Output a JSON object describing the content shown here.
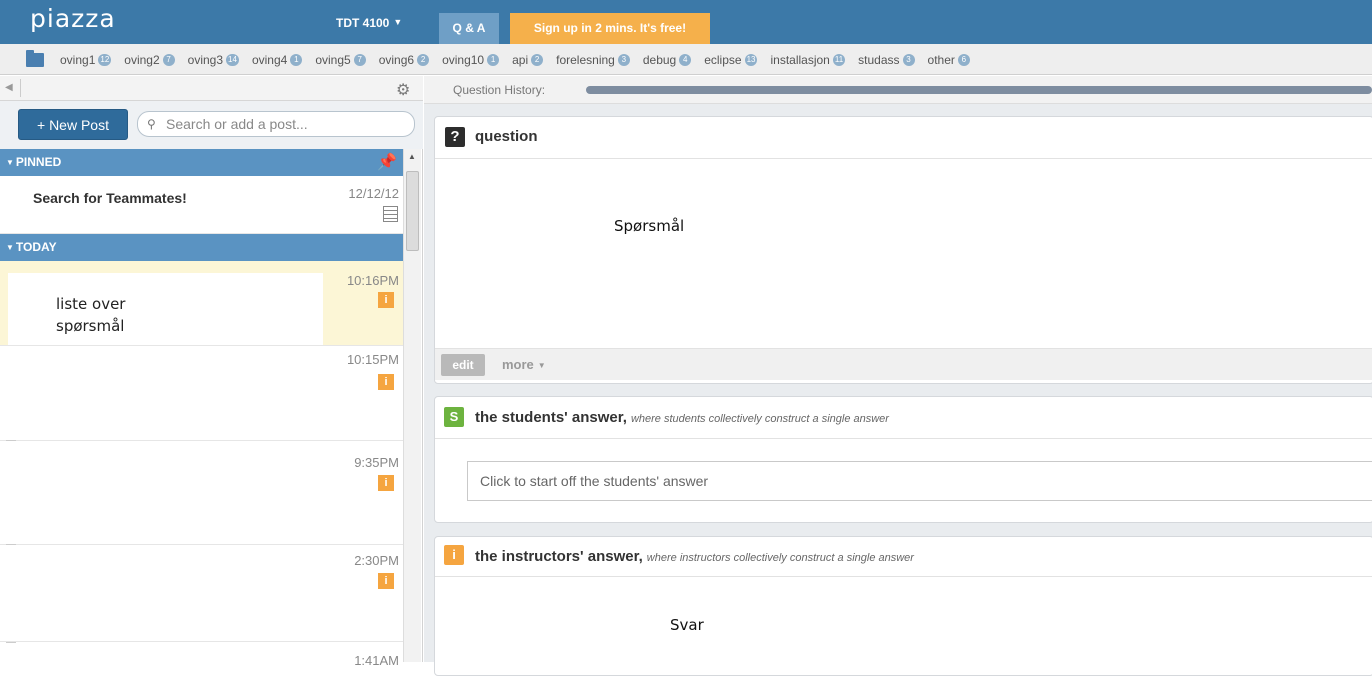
{
  "topbar": {
    "logo": "piazza",
    "course": "TDT 4100",
    "course_caret": "▼",
    "tab_qa": "Q & A",
    "signup": "Sign up in 2 mins. It's free!"
  },
  "folders": [
    {
      "name": "oving1",
      "count": "12"
    },
    {
      "name": "oving2",
      "count": "7"
    },
    {
      "name": "oving3",
      "count": "14"
    },
    {
      "name": "oving4",
      "count": "1"
    },
    {
      "name": "oving5",
      "count": "7"
    },
    {
      "name": "oving6",
      "count": "2"
    },
    {
      "name": "oving10",
      "count": "1"
    },
    {
      "name": "api",
      "count": "2"
    },
    {
      "name": "forelesning",
      "count": "3"
    },
    {
      "name": "debug",
      "count": "4"
    },
    {
      "name": "eclipse",
      "count": "13"
    },
    {
      "name": "installasjon",
      "count": "11"
    },
    {
      "name": "studass",
      "count": "3"
    },
    {
      "name": "other",
      "count": "6"
    }
  ],
  "left": {
    "new_post": "+ New Post",
    "search_placeholder": "Search or add a post...",
    "pinned_label": "PINNED",
    "today_label": "TODAY",
    "pinned_post": {
      "title": "Search for Teammates!",
      "date": "12/12/12"
    },
    "posts": [
      {
        "time": "10:16PM",
        "body_line1": "liste over",
        "body_line2": "spørsmål"
      },
      {
        "time": "10:15PM"
      },
      {
        "time": "9:35PM"
      },
      {
        "time": "2:30PM"
      },
      {
        "time": "1:41AM"
      }
    ],
    "instructor_icon": "i"
  },
  "right": {
    "history_label": "Question History:",
    "question": {
      "icon": "?",
      "title": "question",
      "body": "Spørsmål",
      "edit": "edit",
      "more": "more",
      "more_caret": "▼"
    },
    "students": {
      "icon": "S",
      "title": "the students' answer,",
      "subtitle": "where students collectively construct a single answer",
      "placeholder": "Click to start off the students' answer"
    },
    "instructors": {
      "icon": "i",
      "title": "the instructors' answer,",
      "subtitle": "where instructors collectively construct a single answer",
      "body": "Svar"
    }
  }
}
